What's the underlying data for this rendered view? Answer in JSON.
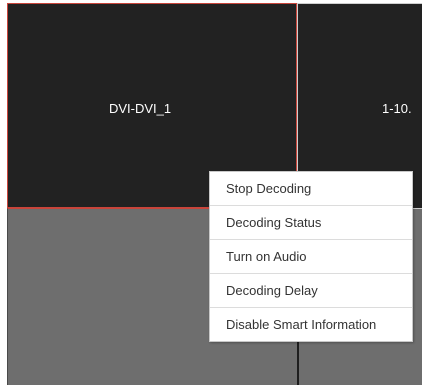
{
  "video_wall": {
    "tiles": [
      {
        "label": "DVI-DVI_1"
      },
      {
        "label": "1-10."
      },
      {
        "label": ""
      },
      {
        "label": ""
      }
    ]
  },
  "context_menu": {
    "items": [
      {
        "label": "Stop Decoding"
      },
      {
        "label": "Decoding Status"
      },
      {
        "label": "Turn on Audio"
      },
      {
        "label": "Decoding Delay"
      },
      {
        "label": "Disable Smart Information"
      }
    ]
  },
  "colors": {
    "tile_active_bg": "#222222",
    "tile_empty_bg": "#6e6e6e",
    "selected_border": "#c9453b"
  }
}
